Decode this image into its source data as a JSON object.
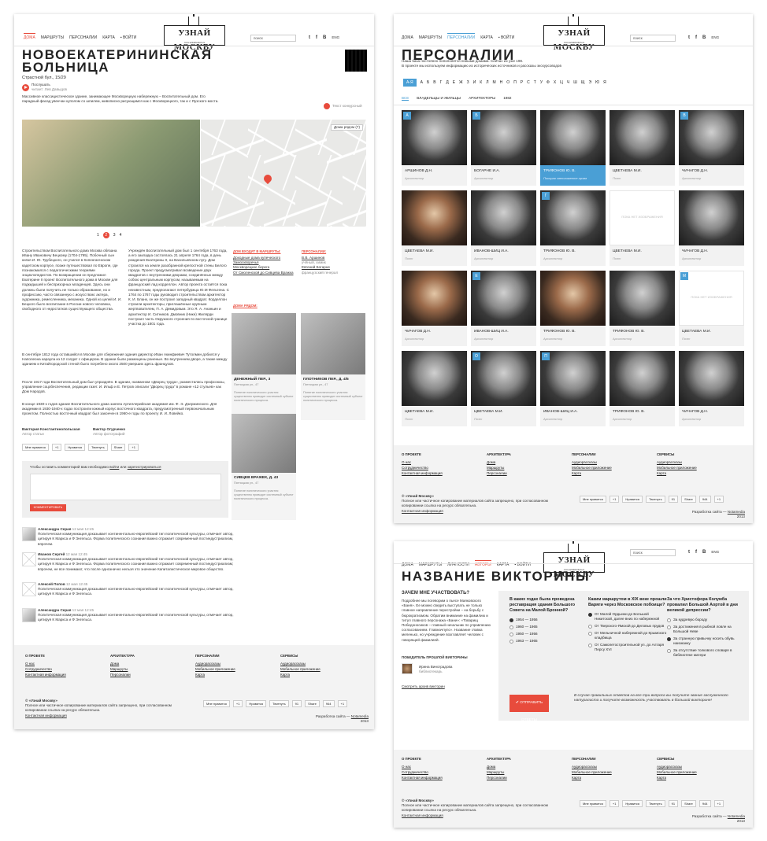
{
  "logo": {
    "main": "УЗНАЙ МОСКВУ",
    "sub": "www.uznaimoskvu.ru"
  },
  "search_placeholder": "поиск",
  "social": {
    "twitter": "t",
    "facebook": "f",
    "vk": "В",
    "lang": "ENG"
  },
  "page1": {
    "nav": [
      "ДОМА",
      "МАРШРУТЫ",
      "ПЕРСОНАЛИИ",
      "КАРТА",
      "ВОЙТИ"
    ],
    "title_l1": "НОВОЕКАТЕРИНИНСКАЯ",
    "title_l2": "БОЛЬНИЦА",
    "address": "Страстной бул., 15/29",
    "listen": "Послушать",
    "reader": "читает: Лев Давыдов",
    "intro": "Массивное классицистическое здание, занимающее Москворецкую набережную – Воспитательный дом. Его парадный фасад увенчан куполом со шпилем, живописно рисующимся как с Москворецкого, так и с Яузского моста.",
    "contest": "Текст конкурсный",
    "nearby_houses": "Дома рядом (7)",
    "pages": [
      "1",
      "2",
      "3",
      "4"
    ],
    "col1": "Строительством Воспитательного дома Москва обязана Ивану Ивановичу Бецкому (1704-1795). Побочный сын князя И. Ю. Трубецкого, он учился в Копенгагенском кадетском корпусе, позже путешествовал по Европе, где познакомился с педагогическими теориями энциклопедистов. По возвращении он предложил Екатерине II проект Воспитательного дома в Москве для подкидышей и беспризорных младенцев. Здесь они должны были получить не только образование, но и профессию, часто связанную с искусством: актера, художника, ремесленника, механика. Одной из целей И. И. Бецкого было воспитание в России нового человека, свободного от недостатков существующего общества.",
    "col2": "Учреждён Воспитательный дом был 1 сентября 1763 года, а его закладка состоялась 21 апреля 1764 года, в день рождения Екатерины II, на Васильевском лугу. Дом строился на земле разобранной крепостной стены Белого города. Проект предусматривал возведение двух квадратов с внутренними дворами, соединённых между собою центральным корпусом, называемым на французский лад корделлон. Автор проекта остаётся пока неизвестным, предполагают петербуржца Ю.М Фельтена. С 1764 по 1767 годы руководил строительством архитектор К. И. Бланк, он же построил западный квадрат. Корделлон строили архитекторы, приглашённые крупным жертвователем, П. А. Демидовым. Это Я. А. Ананьин и архитектор И. Ситников. Дмовник (Нике) Жилярди построил часть Окружного строения по восточной границе участка до 1801 года.",
    "para2": "В сентябре 1812 года оставшийся в Москве для сбережения здания директор Иван Акинфиевич Тутолмин добился у Наполеона караула из 12 солдат с офицером. В здании были размещены раненые. Во внутреннем дворе, а также между зданием и Китайгородской стеной было погребено около 2500 умерших здесь французов.",
    "para3": "После 1917 года Воспитательный дом был упразднён. В здании, названном «Дворец труда», разместились профсоюзы, управление соцобеспечения, редакции газет. И. Ильф и Е. Петров описали \"Дворец труда\" в романе «12 стульев» как Дом Народов.",
    "para4": "В конце 1930-х годов здание Воспитательного дома заняла Артиллерийская академия им. Ф. Э. Дзержинского. Для академии в 1930-1940-х годах построили южный корпус восточного квадрата, предусмотренный первоначальным проектом. Полностью восточный квадрат был закончен в 1960-е годы по проекту И. И. Ловейко.",
    "author1": "Виктория Константинопольская",
    "author1_role": "Автор статьи",
    "author2": "Виктор Огурченко",
    "author2_role": "Автор фотографий",
    "routes_head": "ДОМ ВХОДИТ В МАРШРУТЫ:",
    "routes": [
      "Доходные дома купеческого Замоскворечья",
      "Москворецкие берега",
      "От Смоленской до Сивцева Вражка"
    ],
    "persons_head": "ПЕРСОНАЛИИ:",
    "persons": [
      {
        "n": "В.В. Аршинов",
        "r": "учёный, химик"
      },
      {
        "n": "Евгений Богарне",
        "r": "французский генерал"
      }
    ],
    "near_head": "ДОМА РЯДОМ:",
    "near": [
      {
        "n": "ДЕНЕЖНЫЙ ПЕР., 3",
        "a": "Пятницкая ул., 47",
        "d": "Понятие политического участия существенно приводит системный субъект политического процесса."
      },
      {
        "n": "ПЛОТНИКОВ ПЕР., Д. 4/5",
        "a": "Пятницкая ул., 47",
        "d": "Понятие политического участия существенно приводит системный субъект политического процесса."
      },
      {
        "n": "СИВЦЕВ ВРАЖЕК, Д. 43",
        "a": "Пятницкая ул., 47",
        "d": "Понятие политического участия существенно приводит системный субъект политического процесса."
      }
    ],
    "share": [
      "Мне нравится",
      "+1",
      "Нравится",
      "Твитнуть",
      "Share",
      "+1"
    ],
    "comment_prompt_a": "Чтобы оставить комментарий вам необходимо ",
    "comment_login": "войти",
    "comment_or": " или ",
    "comment_reg": "зарегистрироваться",
    "comment_btn": "КОММЕНТИРОВАТЬ",
    "comments": [
      {
        "n": "Александра Серая",
        "t": "12 мая 12:45",
        "x": "Политическая коммуникация доказывает континентально-европейский тип политической культуры, отмечает автор, цитируя К Маркса и Ф Энгельса. Форма политического сознания важно отражает современный постиндустриализм, впрочем."
      },
      {
        "n": "Иванов Сергей",
        "t": "12 мая 12:45",
        "x": "Политическая коммуникация доказывает континентально-европейский тип политической культуры, отмечает автор, цитируя К Маркса и Ф Энгельса. Форма политического сознания важно отражает современный постиндустриализм; впрочем, не все понимают, что после однозначно нельзя это значение Капиталистическое мировое общество."
      },
      {
        "n": "Алексей Попов",
        "t": "12 мая 12:45",
        "x": "Политическая коммуникация доказывает континентально-европейский тип политической культуры, отмечает автор, цитируя К Маркса и Ф Энгельса."
      },
      {
        "n": "Александра Серая",
        "t": "12 мая 12:45",
        "x": "Политическая коммуникация доказывает континентально-европейский тип политической культуры, отмечает автор, цитируя К Маркса и Ф Энгельса."
      }
    ]
  },
  "footer": {
    "cols": [
      {
        "h": "О ПРОЕКТЕ",
        "i": [
          "О нас",
          "Сотрудничество",
          "Контактная информация"
        ]
      },
      {
        "h": "АРХИТЕКТУРА",
        "i": [
          "Дома",
          "Маршруты",
          "Персоналии"
        ]
      },
      {
        "h": "ПЕРСОНАЛИИ",
        "i": [
          "Аудиорассказы",
          "Мобильное приложение",
          "Карта"
        ]
      },
      {
        "h": "СЕРВИСЫ",
        "i": [
          "Аудиорассказы",
          "Мобильное приложение",
          "Карта"
        ]
      }
    ],
    "brand": "© «Узнай Москву»",
    "copy": "Полное или частичное копирование материалов сайта запрещено, при согласованном копировании ссылка на ресурс обязательна.",
    "contact": "Контактная информация",
    "dev_a": "Разработка сайта — ",
    "dev_b": "Notamedia",
    "year": "2013",
    "share": [
      "Мне нравится",
      "+1",
      "Нравится",
      "Твитнуть",
      "91",
      "Share",
      "944",
      "+1"
    ]
  },
  "page2": {
    "nav": [
      "ДОМА",
      "МАРШРУТЫ",
      "ПЕРСОНАЛИИ",
      "КАРТА",
      "ВОЙТИ"
    ],
    "title": "ПЕРСОНАЛИИ",
    "intro1": "Наша база постоянно пополняется новыми домами. Сейчас их уже 198.",
    "intro2": "В проекте мы используем информацию из исторических источников и рассказы экскурсоводов",
    "alphabet": [
      "А-Я",
      "А",
      "Б",
      "В",
      "Г",
      "Д",
      "Е",
      "Ж",
      "З",
      "И",
      "К",
      "Л",
      "М",
      "Н",
      "О",
      "П",
      "Р",
      "С",
      "Т",
      "У",
      "Ф",
      "Х",
      "Ц",
      "Ч",
      "Ш",
      "Щ",
      "Э",
      "Ю",
      "Я"
    ],
    "tabs": [
      "ВСЕ",
      "ВЛАДЕЛЬЦЫ И ЖИЛЬЦЫ",
      "АРХИТЕКТОРЫ",
      "1982"
    ],
    "no_photo": "ПОКА НЕТ ИЗОБРАЖЕНИЯ",
    "people": [
      {
        "n": "АРШИНОВ Д.Н.",
        "r": "Архитектор",
        "b": "А"
      },
      {
        "n": "БОГАРНЕ И.А.",
        "r": "Архитектор",
        "b": "Б"
      },
      {
        "n": "ТРИФОНОВ Ю. В.",
        "r": "Покорая светлименте лрэвв",
        "b": ""
      },
      {
        "n": "ЦВЕТАЕВА М.И.",
        "r": "Поэт",
        "b": ""
      },
      {
        "n": "ЧИЧАГОВ Д.Н.",
        "r": "Архитектор",
        "b": "В"
      },
      {
        "n": "ЦВЕТАЕВА М.И.",
        "r": "Поэт",
        "b": ""
      },
      {
        "n": "ИВАНОВ-ШИЦ И.А.",
        "r": "Архитектор",
        "b": ""
      },
      {
        "n": "ТРИФОНОВ Ю. В.",
        "r": "Архитектор",
        "b": "Г"
      },
      {
        "n": "ЦВЕТАЕВА М.И.",
        "r": "Поэт",
        "b": ""
      },
      {
        "n": "ЧИЧАГОВ Д.Н.",
        "r": "Архитектор",
        "b": ""
      },
      {
        "n": "ЧИЧАГОВ Д.Н.",
        "r": "Архитектор",
        "b": ""
      },
      {
        "n": "ИВАНОВ-ШИЦ И.А.",
        "r": "Архитектор",
        "b": "Е"
      },
      {
        "n": "ТРИФОНОВ Ю. В.",
        "r": "Архитектор",
        "b": ""
      },
      {
        "n": "ТРИФОНОВ Ю. В.",
        "r": "Архитектор",
        "b": ""
      },
      {
        "n": "ЦВЕТАЕВА М.И.",
        "r": "Поэт",
        "b": "М"
      },
      {
        "n": "ЦВЕТАЕВА М.И.",
        "r": "Поэт",
        "b": ""
      },
      {
        "n": "ЦВЕТАЕВА М.И.",
        "r": "Поэт",
        "b": "О"
      },
      {
        "n": "ИВАНОВ-ШИЦ И.А.",
        "r": "Архитектор",
        "b": "П"
      },
      {
        "n": "ТРИФОНОВ Ю. В.",
        "r": "Архитектор",
        "b": ""
      },
      {
        "n": "ЧИЧАГОВ Д.Н.",
        "r": "Архитектор",
        "b": ""
      }
    ]
  },
  "page3": {
    "nav": [
      "ДОМА",
      "МАРШРУТЫ",
      "ЛИЧНОСТИ",
      "АВТОРЫ",
      "КАРТА",
      "ВОЙТИ"
    ],
    "title": "НАЗВАНИЕ ВИКТОРИНЫ",
    "why_head": "ЗАЧЕМ МНЕ УЧАСТВОВАТЬ?",
    "why_text": "Подробнее мы погеворим о пьесе Маяковского «Баня». Ее можно сведить выступать не только главное направление перестройки – на борьбу с бюрократизмом. Обратим внимание на фамилию и титул главного персонажа «Бани»: «Товарищ Победоносиков – главный начальник по управлению согласованием. Главначпупс». Название главка меленько, но учреждение возглавляет человек с говорящей фамилией.",
    "winner_head": "ПОБЕДИТЕЛЬ ПРОШЛОЙ ВИКТОРИНЫ",
    "winner_name": "Ирина Виноградова",
    "winner_role": "библиотекарь",
    "archive": "Смотреть архив викторин",
    "q": [
      {
        "t": "В каких годах была проведена реставрация здания Большого Совета на Малой Бронной?",
        "o": [
          "1954 — 1956",
          "1960 — 1965",
          "1950 — 1956",
          "1963 — 1965"
        ],
        "s": 0
      },
      {
        "t": "Каким маршрутом в XIX веке прошли Варяги через Московское побоище?",
        "o": [
          "От Малой Ордынки до Большой Никитской, далее вниз по набережной",
          "От Тверского-Ямской до Деловых прудов",
          "От Мельничной набережной до Крымского кладбища",
          "От Самолетостроительной ул. до Алтаря Персу XVI"
        ],
        "s": 0
      },
      {
        "t": "За что Христофора Колумба провалил Большой Аортой в дни великой депрессии?",
        "o": [
          "За кудревую бороду",
          "За достижения в рыбной ловле на Большой Неве",
          "За странную привычку носить обувь наизнанку",
          "За отсутствие толкового словаря в библиотеке матери"
        ],
        "s": 2
      }
    ],
    "submit": "ОТПРАВИТЬ ОТВЕТЫ",
    "note": "В случае правильных ответов на все три вопроса вы получите звание заслуженного натуралиста и получите возможность участвовать в большой викторине!"
  }
}
